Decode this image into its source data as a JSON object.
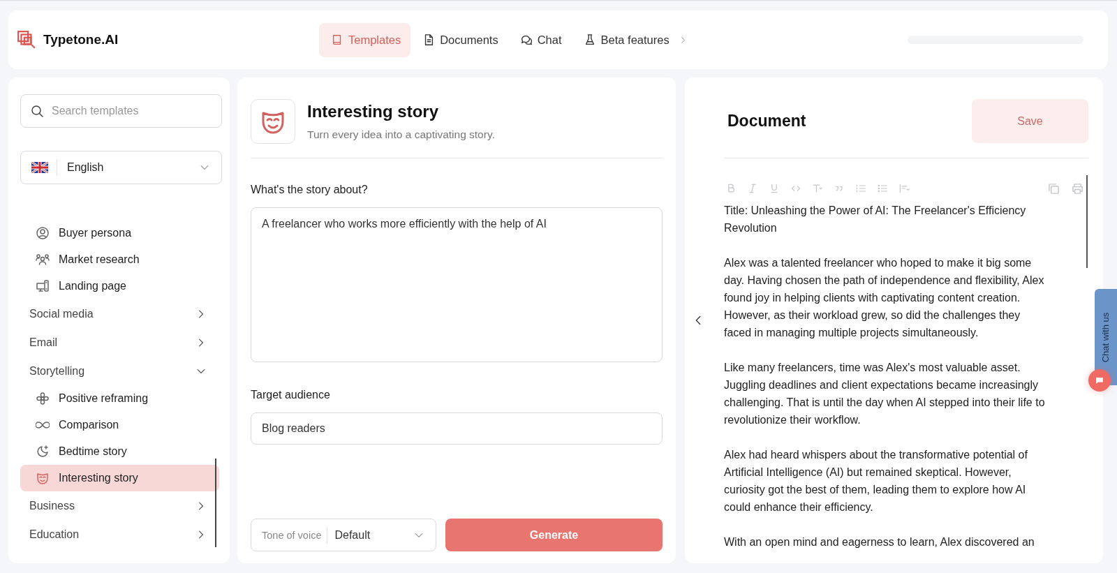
{
  "app": {
    "name": "Typetone.AI"
  },
  "nav": [
    {
      "label": "Templates",
      "selected": true,
      "submenu": false
    },
    {
      "label": "Documents",
      "selected": false,
      "submenu": false
    },
    {
      "label": "Chat",
      "selected": false,
      "submenu": false
    },
    {
      "label": "Beta features",
      "selected": false,
      "submenu": true
    }
  ],
  "sidebar": {
    "search": {
      "placeholder": "Search templates"
    },
    "language": {
      "value": "English"
    },
    "items": [
      {
        "kind": "template",
        "label": "Buyer persona",
        "selected": false
      },
      {
        "kind": "template",
        "label": "Market research",
        "selected": false
      },
      {
        "kind": "template",
        "label": "Landing page",
        "selected": false
      },
      {
        "kind": "category",
        "label": "Social media",
        "expanded": false
      },
      {
        "kind": "category",
        "label": "Email",
        "expanded": false
      },
      {
        "kind": "category",
        "label": "Storytelling",
        "expanded": true,
        "children": [
          {
            "kind": "template",
            "label": "Positive reframing",
            "selected": false
          },
          {
            "kind": "template",
            "label": "Comparison",
            "selected": false
          },
          {
            "kind": "template",
            "label": "Bedtime story",
            "selected": false
          },
          {
            "kind": "template",
            "label": "Interesting story",
            "selected": true
          }
        ]
      },
      {
        "kind": "category",
        "label": "Business",
        "expanded": false
      },
      {
        "kind": "category",
        "label": "Education",
        "expanded": false
      }
    ]
  },
  "template": {
    "title": "Interesting story",
    "subtitle": "Turn every idea into a captivating story.",
    "fields": [
      {
        "kind": "textarea",
        "label": "What's the story about?",
        "value": "A freelancer who works more efficiently with the help of AI"
      },
      {
        "kind": "input",
        "label": "Target audience",
        "value": "Blog readers"
      }
    ],
    "tone": {
      "label": "Tone of voice",
      "value": "Default"
    },
    "generate_button": "Generate"
  },
  "document": {
    "title": "Document",
    "save_button": "Save",
    "paragraphs": [
      {
        "lines": [
          "Title: Unleashing the Power of AI: The Freelancer's Efficiency",
          "Revolution"
        ]
      },
      {
        "lines": [
          "Alex was a talented freelancer who hoped to make it big some",
          "day. Having chosen the path of independence and flexibility, Alex",
          "found joy in helping clients with captivating content creation.",
          "However, as their workload grew, so did the challenges they",
          "faced in managing multiple projects simultaneously."
        ]
      },
      {
        "lines": [
          "Like many freelancers, time was Alex's most valuable asset.",
          "Juggling deadlines and client expectations became increasingly",
          "challenging. That is until the day when AI stepped into their life to",
          "revolutionize their workflow."
        ]
      },
      {
        "lines": [
          "Alex had heard whispers about the transformative potential of",
          "Artificial Intelligence (AI) but remained skeptical. However,",
          "curiosity got the best of them, leading them to explore how AI",
          "could enhance their efficiency."
        ]
      },
      {
        "lines": [
          "With an open mind and eagerness to learn, Alex discovered an"
        ]
      }
    ]
  },
  "chat_widget": {
    "label": "Chat with us"
  }
}
